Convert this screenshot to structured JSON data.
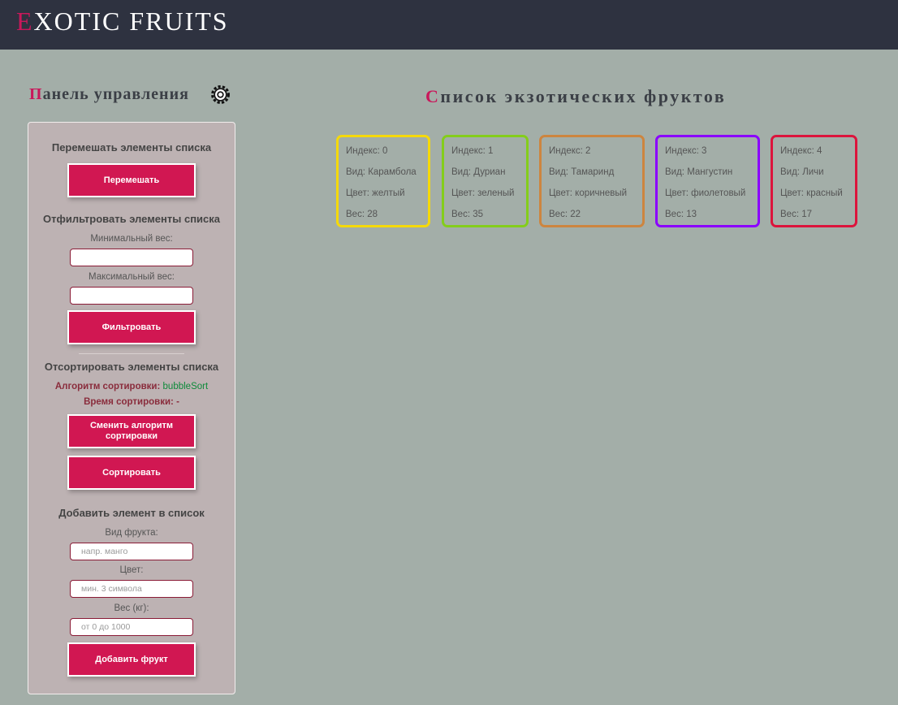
{
  "header": {
    "logo_first": "E",
    "logo_rest": "XOTIC FRUITS"
  },
  "panel": {
    "title_first": "П",
    "title_rest": "анель управления",
    "gear_icon": "gear-icon",
    "shuffle": {
      "title": "Перемешать элементы списка",
      "button": "Перемешать"
    },
    "filter": {
      "title": "Отфильтровать элементы списка",
      "min_label": "Минимальный вес:",
      "min_value": "",
      "max_label": "Максимальный вес:",
      "max_value": "",
      "button": "Фильтровать"
    },
    "sort": {
      "title": "Отсортировать элементы списка",
      "algo_label": "Алгоритм сортировки:",
      "algo_value": "bubbleSort",
      "time_label": "Время сортировки:",
      "time_value": "-",
      "change_button": "Сменить алгоритм сортировки",
      "sort_button": "Сортировать"
    },
    "add": {
      "title": "Добавить элемент в список",
      "kind_label": "Вид фрукта:",
      "kind_placeholder": "напр. манго",
      "color_label": "Цвет:",
      "color_placeholder": "мин. 3 символа",
      "weight_label": "Вес (кг):",
      "weight_placeholder": "от 0 до 1000",
      "button": "Добавить фрукт"
    }
  },
  "list": {
    "title_first": "С",
    "title_rest": "писок экзотических фруктов",
    "fruits": [
      {
        "index": "Индекс: 0",
        "kind": "Вид: Карамбола",
        "color": "Цвет: желтый",
        "weight": "Вес: 28",
        "border": "#f5d90a"
      },
      {
        "index": "Индекс: 1",
        "kind": "Вид: Дуриан",
        "color": "Цвет: зеленый",
        "weight": "Вес: 35",
        "border": "#84cd1b"
      },
      {
        "index": "Индекс: 2",
        "kind": "Вид: Тамаринд",
        "color": "Цвет: коричневый",
        "weight": "Вес: 22",
        "border": "#cd853f"
      },
      {
        "index": "Индекс: 3",
        "kind": "Вид: Мангустин",
        "color": "Цвет: фиолетовый",
        "weight": "Вес: 13",
        "border": "#8b00ff"
      },
      {
        "index": "Индекс: 4",
        "kind": "Вид: Личи",
        "color": "Цвет: красный",
        "weight": "Вес: 17",
        "border": "#dc143c"
      }
    ]
  },
  "colors": {
    "accent": "#d11752",
    "header_bg": "#2e3240",
    "page_bg": "#a3aea8",
    "panel_bg": "#bdb2b3"
  }
}
